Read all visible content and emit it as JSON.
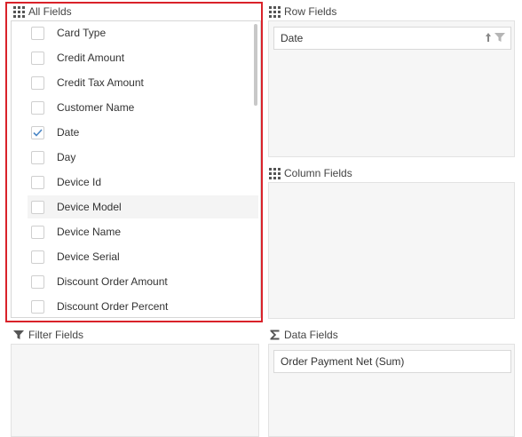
{
  "all_fields": {
    "title": "All Fields",
    "title_icon": "grid-icon",
    "items": [
      {
        "label": "Card Type",
        "checked": false
      },
      {
        "label": "Credit Amount",
        "checked": false
      },
      {
        "label": "Credit Tax Amount",
        "checked": false
      },
      {
        "label": "Customer Name",
        "checked": false
      },
      {
        "label": "Date",
        "checked": true
      },
      {
        "label": "Day",
        "checked": false
      },
      {
        "label": "Device Id",
        "checked": false
      },
      {
        "label": "Device Model",
        "checked": false,
        "hovered": true
      },
      {
        "label": "Device Name",
        "checked": false
      },
      {
        "label": "Device Serial",
        "checked": false
      },
      {
        "label": "Discount Order Amount",
        "checked": false
      },
      {
        "label": "Discount Order Percent",
        "checked": false
      }
    ]
  },
  "row_fields": {
    "title": "Row Fields",
    "title_icon": "grid-icon",
    "items": [
      {
        "label": "Date",
        "icons": [
          "sort-ascending-icon",
          "filter-icon"
        ]
      }
    ]
  },
  "column_fields": {
    "title": "Column Fields",
    "title_icon": "grid-icon",
    "items": []
  },
  "filter_fields": {
    "title": "Filter Fields",
    "title_icon": "filter-icon",
    "items": []
  },
  "data_fields": {
    "title": "Data Fields",
    "title_icon": "sigma-icon",
    "items": [
      {
        "label": "Order Payment Net (Sum)"
      }
    ]
  },
  "colors": {
    "highlight_border": "#d9222a",
    "checkmark": "#4a86c5",
    "zone_background": "#f6f6f6"
  }
}
